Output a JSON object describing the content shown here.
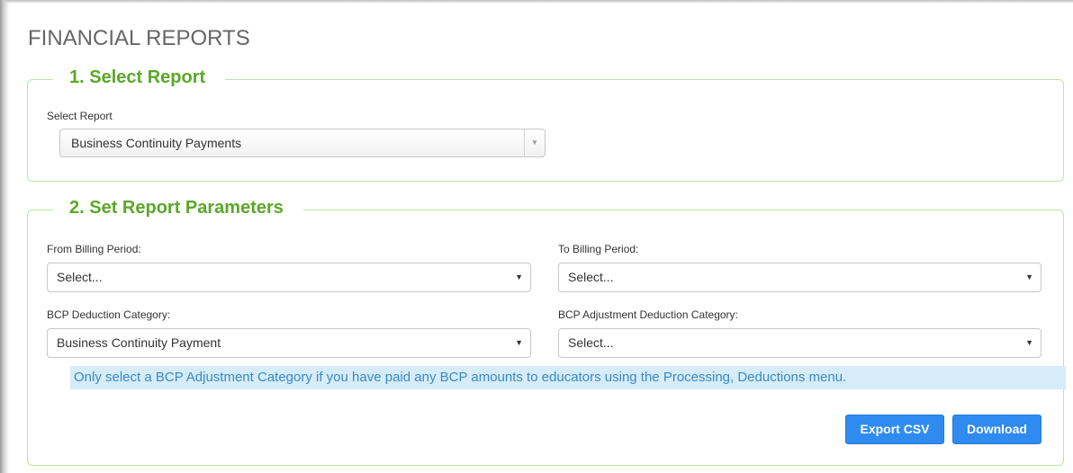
{
  "page": {
    "title": "FINANCIAL REPORTS"
  },
  "section1": {
    "legend": "1. Select Report",
    "report_label": "Select Report",
    "report_value": "Business Continuity Payments"
  },
  "section2": {
    "legend": "2. Set Report Parameters",
    "from_label": "From Billing Period:",
    "from_value": "Select...",
    "to_label": "To Billing Period:",
    "to_value": "Select...",
    "bcp_label": "BCP Deduction Category:",
    "bcp_value": "Business Continuity Payment",
    "bcp_adj_label": "BCP Adjustment Deduction Category:",
    "bcp_adj_value": "Select...",
    "notice": "Only select a BCP Adjustment Category if you have paid any BCP amounts to educators using the Processing, Deductions menu."
  },
  "buttons": {
    "export_csv": "Export CSV",
    "download": "Download"
  },
  "colors": {
    "legend_green": "#5aa829",
    "section_border": "#bfe3a6",
    "notice_bg": "#d6ecf8",
    "notice_text": "#3a8ac4",
    "button_blue": "#2f8bef"
  },
  "icons": {
    "dropdown_arrow": "chevron-down-icon"
  }
}
